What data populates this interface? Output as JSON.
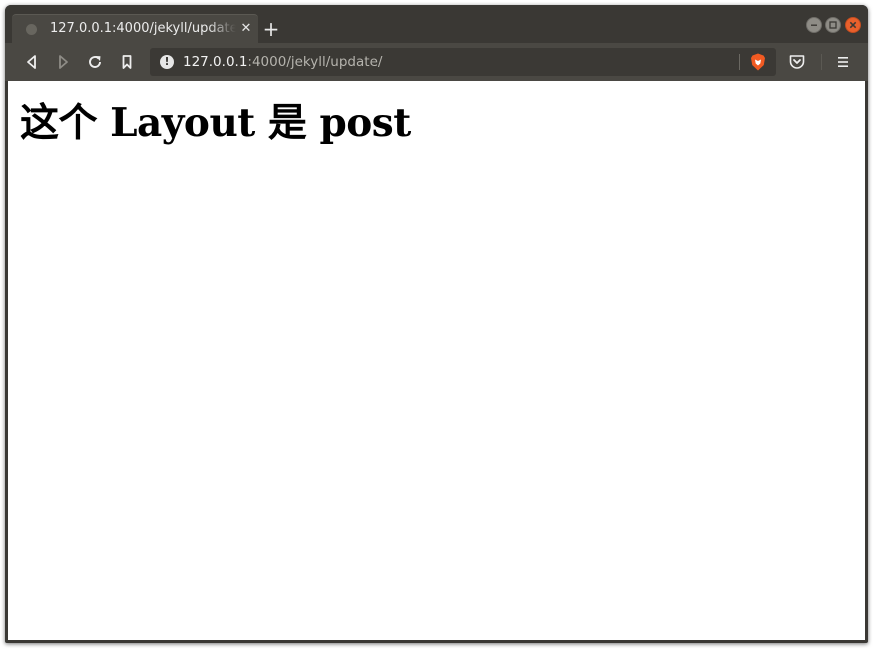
{
  "browser": {
    "tab": {
      "title": "127.0.0.1:4000/jekyll/update/",
      "close_glyph": "✕",
      "favicon": "globe-icon"
    },
    "new_tab_glyph": "+",
    "window_controls": [
      "minimize",
      "maximize",
      "close"
    ],
    "nav": {
      "back": "back-arrow-icon",
      "forward": "forward-arrow-icon",
      "reload": "reload-icon",
      "bookmark": "bookmark-icon"
    },
    "address": {
      "info_glyph": "!",
      "host": "127.0.0.1",
      "path": ":4000/jekyll/update/"
    },
    "toolbar_icons": [
      "brave-shield-icon",
      "pocket-icon",
      "hamburger-menu-icon"
    ],
    "colors": {
      "chrome": "#3a3834",
      "toolbar": "#4a4843",
      "close_button": "#e9602c",
      "brave": "#f15a22"
    }
  },
  "page": {
    "heading": "这个 Layout 是 post"
  }
}
